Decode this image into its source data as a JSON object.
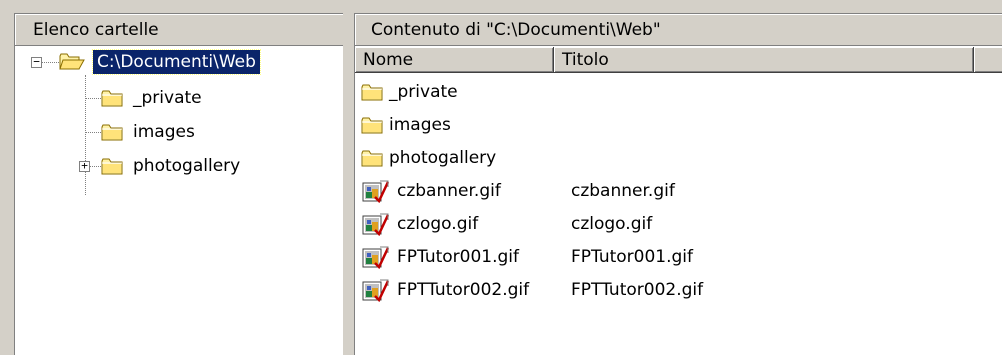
{
  "left_panel": {
    "header": "Elenco cartelle",
    "tree": {
      "root": {
        "label": "C:\\Documenti\\Web",
        "expander": "−",
        "selected": true
      },
      "children": [
        {
          "label": "_private",
          "expander": ""
        },
        {
          "label": "images",
          "expander": ""
        },
        {
          "label": "photogallery",
          "expander": "+"
        }
      ]
    }
  },
  "right_panel": {
    "header": "Contenuto di \"C:\\Documenti\\Web\"",
    "columns": [
      "Nome",
      "Titolo",
      ""
    ],
    "rows": [
      {
        "name": "_private",
        "title": "",
        "icon": "folder-icon"
      },
      {
        "name": "images",
        "title": "",
        "icon": "folder-icon"
      },
      {
        "name": "photogallery",
        "title": "",
        "icon": "folder-icon"
      },
      {
        "name": "czbanner.gif",
        "title": "czbanner.gif",
        "icon": "gif-image-icon"
      },
      {
        "name": "czlogo.gif",
        "title": "czlogo.gif",
        "icon": "gif-image-icon"
      },
      {
        "name": "FPTutor001.gif",
        "title": "FPTutor001.gif",
        "icon": "gif-image-icon"
      },
      {
        "name": "FPTTutor002.gif",
        "title": "FPTTutor002.gif",
        "icon": "gif-image-icon"
      }
    ]
  },
  "colors": {
    "selection_bg": "#0a246a",
    "chrome": "#d4d0c8",
    "folder_yellow": "#ffe680"
  }
}
